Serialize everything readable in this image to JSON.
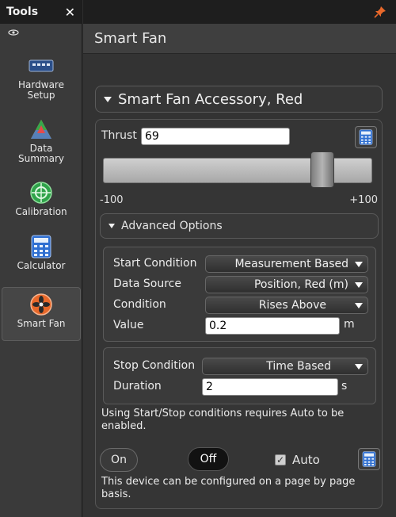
{
  "tools": {
    "title": "Tools",
    "close_glyph": "✕",
    "items": [
      {
        "label": "Hardware\nSetup",
        "icon": "hardware-icon"
      },
      {
        "label": "Data\nSummary",
        "icon": "data-summary-icon"
      },
      {
        "label": "Calibration",
        "icon": "calibration-icon"
      },
      {
        "label": "Calculator",
        "icon": "calculator-icon"
      },
      {
        "label": "Smart Fan",
        "icon": "smart-fan-icon",
        "active": true
      }
    ]
  },
  "panel": {
    "title": "Smart Fan",
    "accessory": "Smart Fan Accessory, Red"
  },
  "thrust": {
    "label": "Thrust",
    "value": "69",
    "min_label": "-100",
    "max_label": "+100",
    "slider_fraction": 0.845
  },
  "advanced": {
    "header": "Advanced Options",
    "start": {
      "condition_label": "Start Condition",
      "condition_value": "Measurement Based",
      "source_label": "Data Source",
      "source_value": "Position, Red (m)",
      "cond_label": "Condition",
      "cond_value": "Rises Above",
      "value_label": "Value",
      "value": "0.2",
      "value_unit": "m"
    },
    "stop": {
      "condition_label": "Stop Condition",
      "condition_value": "Time Based",
      "duration_label": "Duration",
      "duration_value": "2",
      "duration_unit": "s"
    },
    "note": "Using Start/Stop conditions requires Auto to be enabled."
  },
  "controls": {
    "on_label": "On",
    "off_label": "Off",
    "auto_label": "Auto",
    "auto_checked": true,
    "footer_note": "This device can be configured on a page by page basis."
  },
  "colors": {
    "accent_pin": "#e8682a",
    "fan_orange": "#e8682a",
    "calc_blue": "#2f6fd1"
  }
}
